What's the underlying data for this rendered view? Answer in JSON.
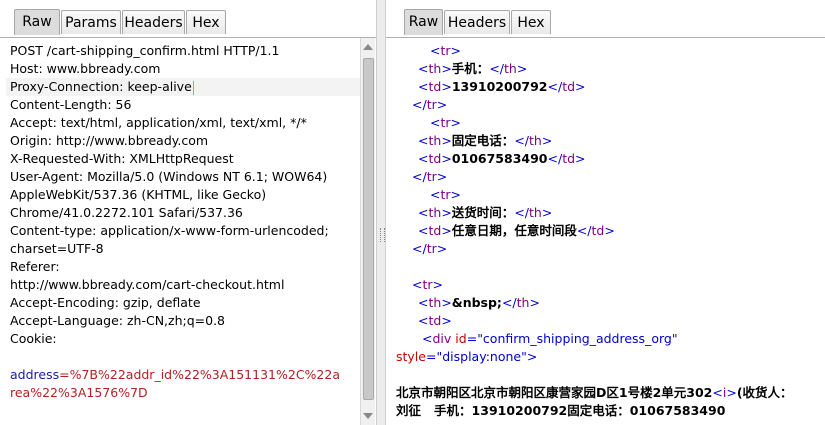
{
  "request": {
    "tabs": [
      "Raw",
      "Params",
      "Headers",
      "Hex"
    ],
    "lines": [
      "POST /cart-shipping_confirm.html HTTP/1.1",
      "Host: www.bbready.com",
      "Proxy-Connection: keep-alive",
      "Content-Length: 56",
      "Accept: text/html, application/xml, text/xml, */*",
      "Origin: http://www.bbready.com",
      "X-Requested-With: XMLHttpRequest",
      "User-Agent: Mozilla/5.0 (Windows NT 6.1; WOW64)",
      "AppleWebKit/537.36 (KHTML, like Gecko)",
      "Chrome/41.0.2272.101 Safari/537.36",
      "Content-type: application/x-www-form-urlencoded;",
      "charset=UTF-8",
      "Referer:",
      "http://www.bbready.com/cart-checkout.html",
      "Accept-Encoding: gzip, deflate",
      "Accept-Language: zh-CN,zh;q=0.8",
      "Cookie:",
      "",
      "",
      ""
    ],
    "body_param_name": "address",
    "body_line1": "%7B%22addr_id%22%3A151131%2C%22a",
    "body_line2": "rea%22%3A1576%7D"
  },
  "response": {
    "tabs": [
      "Raw",
      "Headers",
      "Hex"
    ],
    "phone_label": "手机：",
    "phone_value": "13910200792",
    "fixed_phone_label": "固定电话：",
    "fixed_phone_value": "01067583490",
    "delivery_label": "送货时间：",
    "delivery_value": "任意日期，任意时间段",
    "nbsp": "&nbsp;",
    "div_id_value": "\"confirm_shipping_address_org\"",
    "style_value": "\"display:none\"",
    "address_text": "北京市朝阳区北京市朝阳区康营家园D区1号楼2单元302",
    "receiver_text": "(收货人：",
    "receiver_line": "刘征   手机：13910200792固定电话：01067583490"
  }
}
